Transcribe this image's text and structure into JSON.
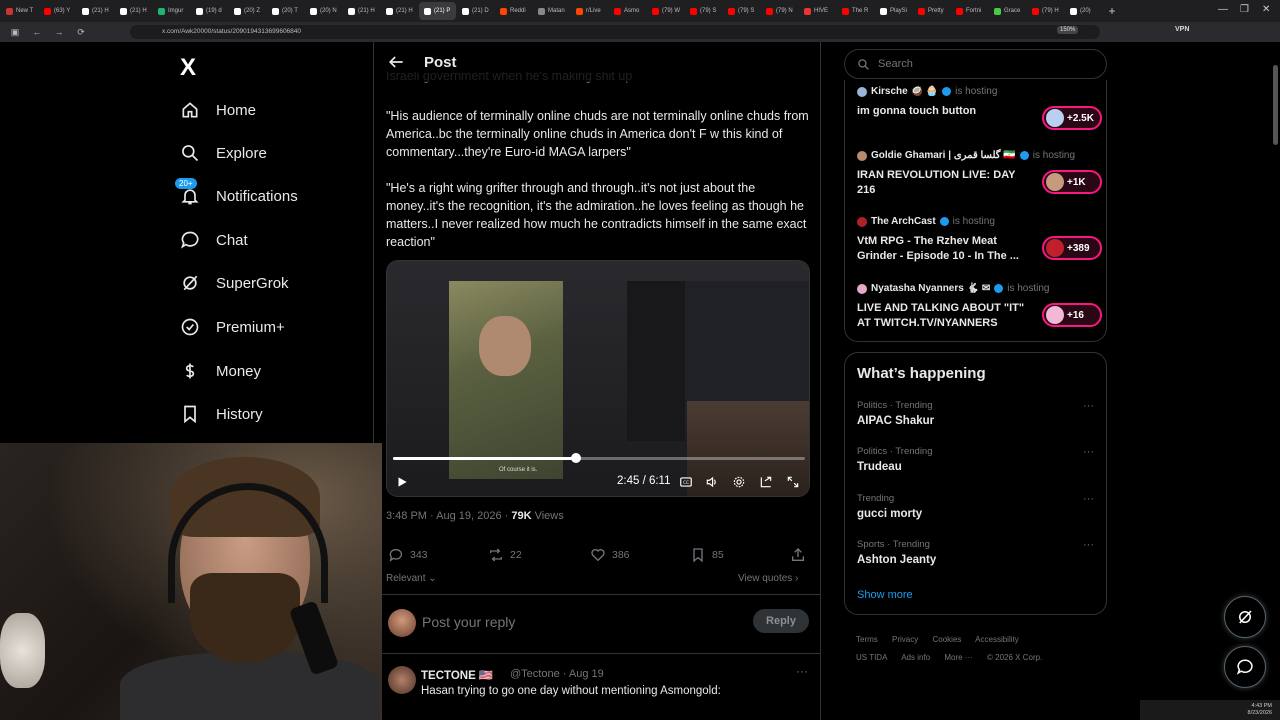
{
  "browser": {
    "tabs": [
      {
        "label": "New T",
        "color": "#c33"
      },
      {
        "label": "(63) Y",
        "color": "#f00"
      },
      {
        "label": "(21) H",
        "color": "#fff"
      },
      {
        "label": "(21) H",
        "color": "#fff"
      },
      {
        "label": "Imgur",
        "color": "#1bb76e"
      },
      {
        "label": "(19) d",
        "color": "#fff"
      },
      {
        "label": "(20) Z",
        "color": "#fff"
      },
      {
        "label": "(20) T",
        "color": "#fff"
      },
      {
        "label": "(20) N",
        "color": "#fff"
      },
      {
        "label": "(21) H",
        "color": "#fff"
      },
      {
        "label": "(21) H",
        "color": "#fff"
      },
      {
        "label": "(21) P",
        "color": "#fff",
        "active": true
      },
      {
        "label": "(21) D",
        "color": "#fff"
      },
      {
        "label": "Reddi",
        "color": "#ff4500"
      },
      {
        "label": "Matan",
        "color": "#888"
      },
      {
        "label": "r/Live",
        "color": "#ff4500"
      },
      {
        "label": "Asmo",
        "color": "#f00"
      },
      {
        "label": "(79) W",
        "color": "#f00"
      },
      {
        "label": "(79) S",
        "color": "#f00"
      },
      {
        "label": "(79) S",
        "color": "#f00"
      },
      {
        "label": "(79) N",
        "color": "#f00"
      },
      {
        "label": "HIVE",
        "color": "#e33"
      },
      {
        "label": "The R",
        "color": "#f00"
      },
      {
        "label": "PlaySi",
        "color": "#fff"
      },
      {
        "label": "Pretty",
        "color": "#f00"
      },
      {
        "label": "Fortni",
        "color": "#f00"
      },
      {
        "label": "Grace",
        "color": "#4c4"
      },
      {
        "label": "(79) H",
        "color": "#f00"
      },
      {
        "label": "(20)",
        "color": "#fff"
      }
    ],
    "url": "x.com/Awk20000/status/2090194313699606840",
    "zoom": "150%",
    "vpn": "VPN"
  },
  "nav": {
    "logo": "X",
    "items": [
      {
        "label": "Home",
        "icon": "home-icon"
      },
      {
        "label": "Explore",
        "icon": "search-icon"
      },
      {
        "label": "Notifications",
        "icon": "bell-icon"
      },
      {
        "label": "Chat",
        "icon": "chat-icon"
      },
      {
        "label": "SuperGrok",
        "icon": "grok-icon"
      },
      {
        "label": "Premium+",
        "icon": "verified-badge-icon"
      },
      {
        "label": "Money",
        "icon": "dollar-icon"
      },
      {
        "label": "History",
        "icon": "bookmark-icon"
      }
    ],
    "notifications_badge": "20+"
  },
  "post": {
    "header_title": "Post",
    "clipped_line": "Israeli government when he's making shit up",
    "paragraphs": [
      "\"His audience of terminally online chuds are not terminally online chuds from America..bc the terminally online chuds in America don't F w this kind of commentary...they're Euro-id MAGA larpers\"",
      "\"He's a right wing grifter through and through..it's not just about the money..it's the recognition, it's the admiration..he loves feeling as though he matters..I never realized how much he contradicts himself in the same exact reaction\""
    ],
    "video": {
      "current_time": "2:45",
      "duration": "6:11",
      "time_display": "2:45 / 6:11",
      "progress": 0.445,
      "caption": "Of course it is."
    },
    "meta": {
      "timestamp": "3:48 PM · Aug 19, 2026 · ",
      "views_count": "79K",
      "views_label": " Views"
    },
    "actions": {
      "replies": "343",
      "reposts": "22",
      "likes": "386",
      "bookmarks": "85"
    },
    "sort_label": "Relevant",
    "view_quotes": "View quotes",
    "reply_placeholder": "Post your reply",
    "reply_button": "Reply"
  },
  "next_tweet": {
    "name": "TECTONE 🇺🇸",
    "handle": "@Tectone · Aug 19",
    "text": "Hasan trying to go one day without mentioning Asmongold:"
  },
  "sidebar": {
    "search_placeholder": "Search",
    "spaces": [
      {
        "host": "Kirsche 🥥 🧁",
        "hosting": "is hosting",
        "title": "im gonna touch button",
        "count": "+2.5K"
      },
      {
        "host": "Goldie Ghamari | گلسا قمری 🇮🇷",
        "hosting": "is hosting",
        "title": "IRAN REVOLUTION LIVE: DAY 216",
        "count": "+1K"
      },
      {
        "host": "The ArchCast",
        "hosting": "is hosting",
        "title": "VtM RPG - The Rzhev Meat Grinder - Episode 10 - In The ...",
        "count": "+389"
      },
      {
        "host": "Nyatasha Nyanners 🐇 ✉",
        "hosting": "is hosting",
        "title": "LIVE AND TALKING ABOUT \"IT\" AT TWITCH.TV/NYANNERS",
        "count": "+16"
      }
    ],
    "trends_title": "What’s happening",
    "trends": [
      {
        "category": "Politics · Trending",
        "name": "AIPAC Shakur"
      },
      {
        "category": "Politics · Trending",
        "name": "Trudeau"
      },
      {
        "category": "Trending",
        "name": "gucci morty"
      },
      {
        "category": "Sports · Trending",
        "name": "Ashton Jeanty"
      }
    ],
    "show_more": "Show more",
    "footer": [
      "Terms",
      "Privacy",
      "Cookies",
      "Accessibility",
      "US TIDA",
      "Ads info",
      "More ···",
      "© 2026 X Corp."
    ]
  },
  "taskbar": {
    "time": "4:43 PM",
    "date": "8/23/2026"
  },
  "colors": {
    "accent": "#1d9bf0",
    "live_pink": "#f91880",
    "muted_text": "#71767b",
    "border": "#2f3336"
  }
}
